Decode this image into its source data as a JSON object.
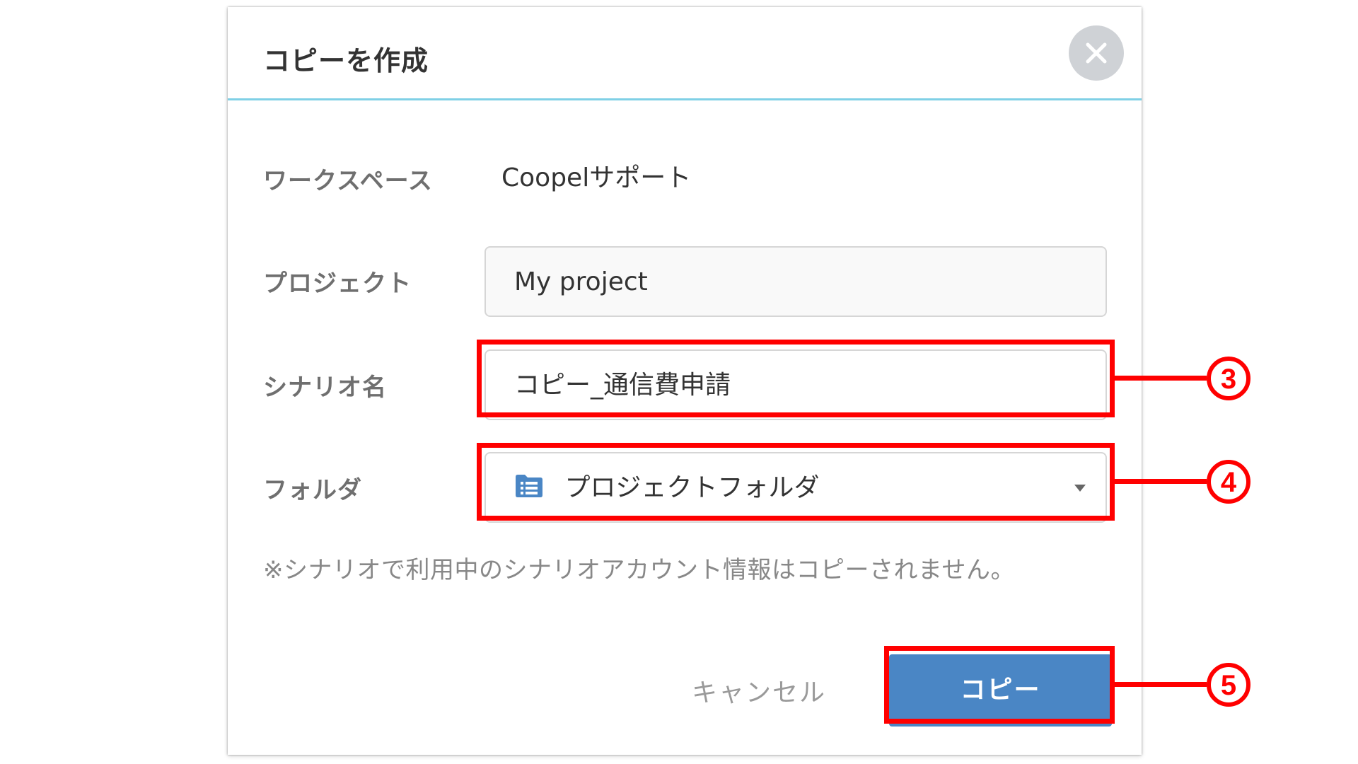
{
  "dialog": {
    "title": "コピーを作成",
    "close_icon": "close-icon"
  },
  "form": {
    "workspace_label": "ワークスペース",
    "workspace_value": "Coopelサポート",
    "project_label": "プロジェクト",
    "project_value": "My project",
    "scenario_label": "シナリオ名",
    "scenario_value": "コピー_通信費申請",
    "folder_label": "フォルダ",
    "folder_value": "プロジェクトフォルダ",
    "folder_icon": "folder-list-icon",
    "note": "※シナリオで利用中のシナリオアカウント情報はコピーされません。"
  },
  "actions": {
    "cancel_label": "キャンセル",
    "copy_label": "コピー"
  },
  "annotations": {
    "color": "#ff0000",
    "items": [
      "3",
      "4",
      "5"
    ]
  },
  "colors": {
    "accent_line": "#7fd0e6",
    "primary_button": "#4a86c5"
  }
}
